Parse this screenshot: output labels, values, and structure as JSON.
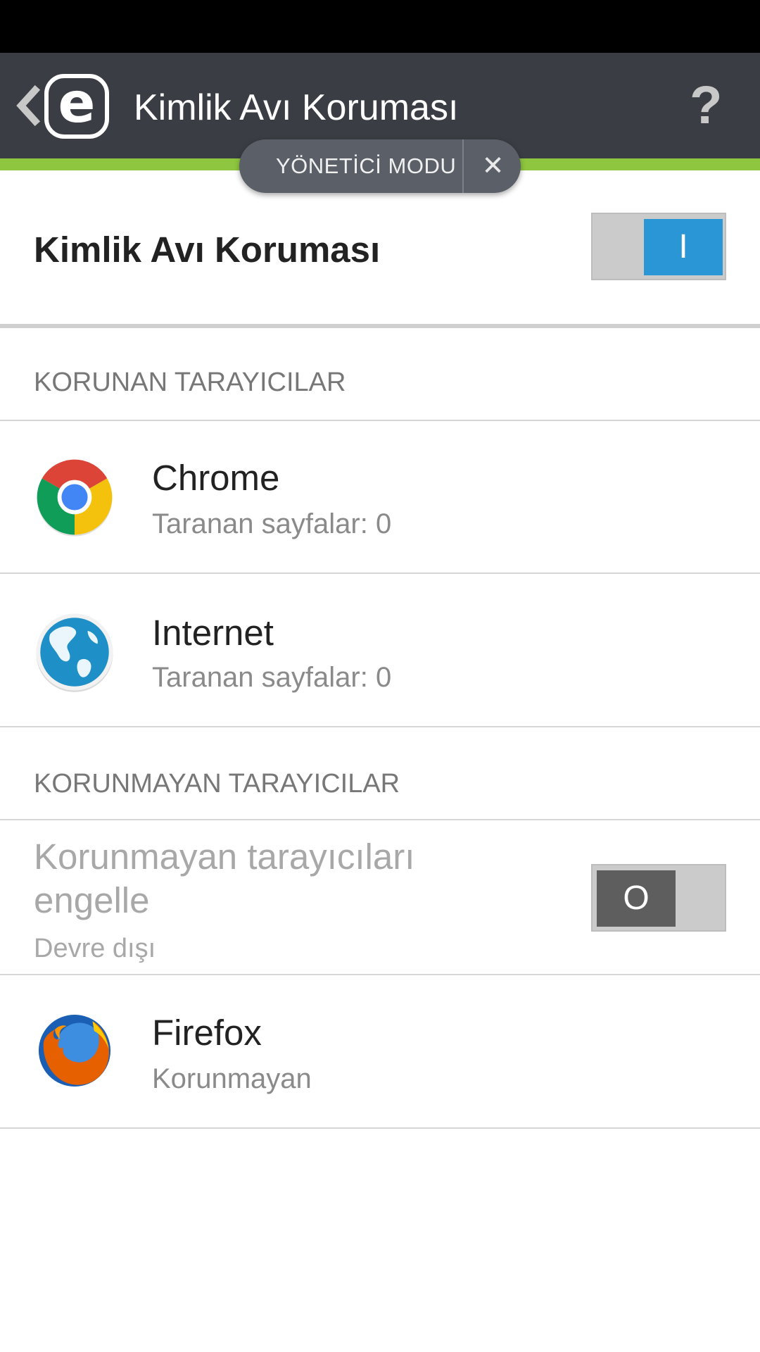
{
  "app_bar": {
    "title": "Kimlik Avı Koruması",
    "logo_letter": "e",
    "help_symbol": "?",
    "back_icon": "chevron-left-icon",
    "help_icon": "question-mark-icon"
  },
  "admin_mode": {
    "label": "YÖNETİCİ MODU",
    "close_symbol": "✕",
    "close_icon": "close-icon"
  },
  "main_switch": {
    "label": "Kimlik Avı Koruması",
    "state": "on",
    "state_glyph": "I"
  },
  "protected_browsers": {
    "header": "KORUNAN TARAYICILAR",
    "items": [
      {
        "name": "Chrome",
        "status": "Taranan sayfalar: 0",
        "icon": "chrome-icon"
      },
      {
        "name": "Internet",
        "status": "Taranan sayfalar: 0",
        "icon": "globe-icon"
      }
    ]
  },
  "unprotected_browsers": {
    "header": "KORUNMAYAN TARAYICILAR",
    "block_setting": {
      "title": "Korunmayan tarayıcıları engelle",
      "status": "Devre dışı",
      "state": "off",
      "state_glyph": "O"
    },
    "items": [
      {
        "name": "Firefox",
        "status": "Korunmayan",
        "icon": "firefox-icon"
      }
    ]
  },
  "colors": {
    "app_bar": "#3a3e44",
    "accent_green": "#8ec63f",
    "toggle_on": "#2b96d6",
    "toggle_off": "#5e5e5e"
  }
}
